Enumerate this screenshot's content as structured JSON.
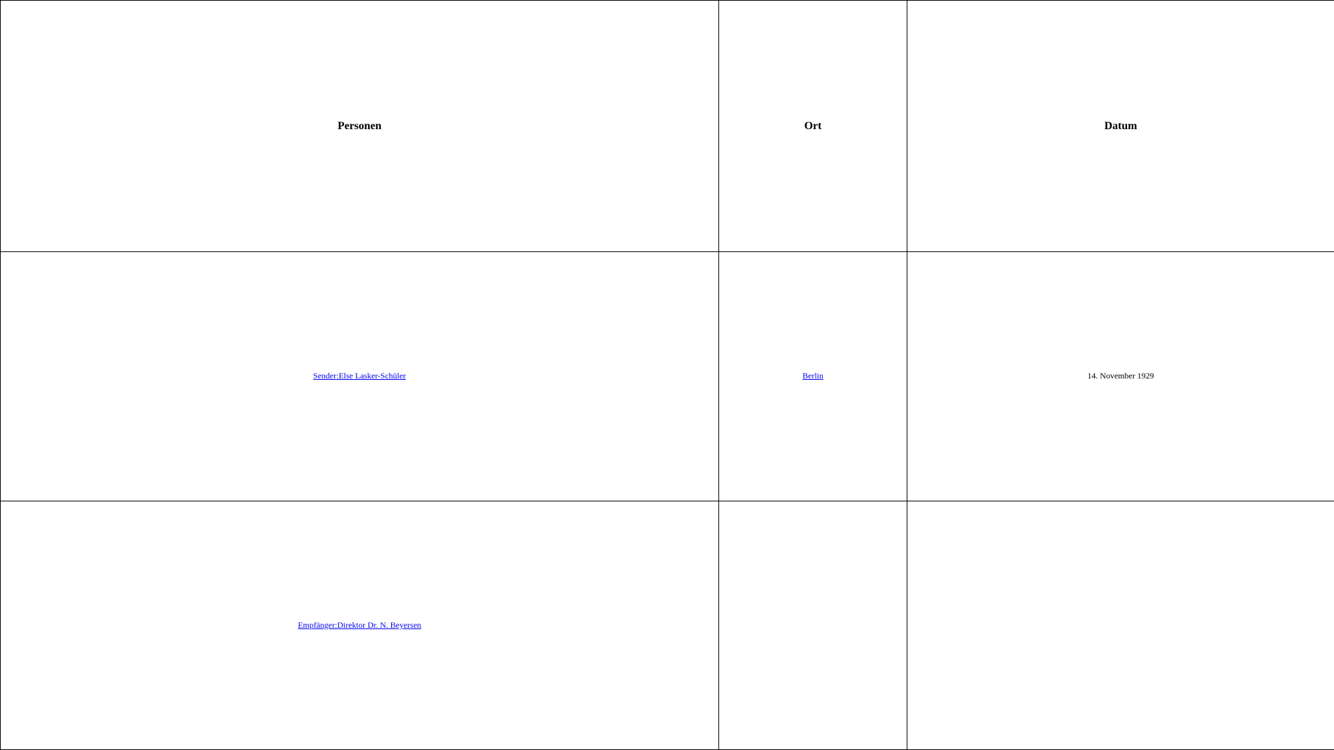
{
  "table": {
    "headers": {
      "persons": "Personen",
      "place": "Ort",
      "date": "Datum"
    },
    "rows": [
      {
        "person": "Sender:Else Lasker-Schüler",
        "place": "Berlin",
        "date": "14. November 1929"
      },
      {
        "person": "Empfänger:Direktor Dr. N. Beyersen",
        "place": "",
        "date": ""
      }
    ]
  },
  "colors": {
    "link": "#0000ee",
    "border": "#000000",
    "background": "#ffffff"
  }
}
